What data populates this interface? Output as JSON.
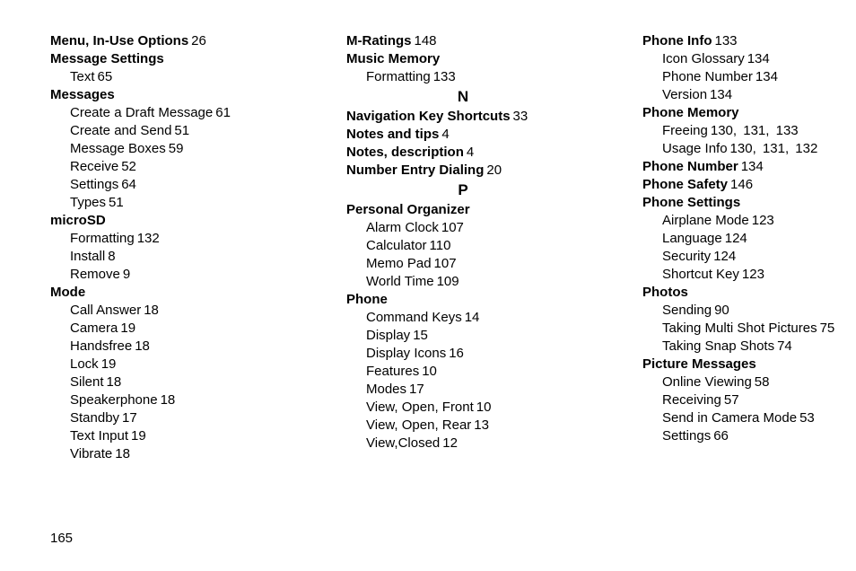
{
  "page_number": "165",
  "columns": [
    [
      {
        "type": "topic",
        "head": "Menu, In-Use Options",
        "page": "26"
      },
      {
        "type": "topic",
        "head": "Message Settings"
      },
      {
        "type": "sub",
        "text": "Text",
        "page": "65"
      },
      {
        "type": "topic",
        "head": "Messages"
      },
      {
        "type": "sub",
        "text": "Create a Draft Message",
        "page": "61"
      },
      {
        "type": "sub",
        "text": "Create and Send",
        "page": "51"
      },
      {
        "type": "sub",
        "text": "Message Boxes",
        "page": "59"
      },
      {
        "type": "sub",
        "text": "Receive",
        "page": "52"
      },
      {
        "type": "sub",
        "text": "Settings",
        "page": "64"
      },
      {
        "type": "sub",
        "text": "Types",
        "page": "51"
      },
      {
        "type": "topic",
        "head": "microSD"
      },
      {
        "type": "sub",
        "text": "Formatting",
        "page": "132"
      },
      {
        "type": "sub",
        "text": "Install",
        "page": "8"
      },
      {
        "type": "sub",
        "text": "Remove",
        "page": "9"
      },
      {
        "type": "topic",
        "head": "Mode"
      },
      {
        "type": "sub",
        "text": "Call Answer",
        "page": "18"
      },
      {
        "type": "sub",
        "text": "Camera",
        "page": "19"
      },
      {
        "type": "sub",
        "text": "Handsfree",
        "page": "18"
      },
      {
        "type": "sub",
        "text": "Lock",
        "page": "19"
      },
      {
        "type": "sub",
        "text": "Silent",
        "page": "18"
      },
      {
        "type": "sub",
        "text": "Speakerphone",
        "page": "18"
      },
      {
        "type": "sub",
        "text": "Standby",
        "page": "17"
      },
      {
        "type": "sub",
        "text": "Text Input",
        "page": "19"
      },
      {
        "type": "sub",
        "text": "Vibrate",
        "page": "18"
      }
    ],
    [
      {
        "type": "topic",
        "head": "M-Ratings",
        "page": "148"
      },
      {
        "type": "topic",
        "head": "Music Memory"
      },
      {
        "type": "sub",
        "text": "Formatting",
        "page": "133"
      },
      {
        "type": "letter",
        "letter": "N"
      },
      {
        "type": "topic",
        "head": "Navigation Key Shortcuts",
        "page": "33"
      },
      {
        "type": "topic",
        "head": "Notes and tips",
        "page": "4"
      },
      {
        "type": "topic",
        "head": "Notes, description",
        "page": "4"
      },
      {
        "type": "topic",
        "head": "Number Entry Dialing",
        "page": "20"
      },
      {
        "type": "letter",
        "letter": "P"
      },
      {
        "type": "topic",
        "head": "Personal Organizer"
      },
      {
        "type": "sub",
        "text": "Alarm Clock",
        "page": "107"
      },
      {
        "type": "sub",
        "text": "Calculator",
        "page": "110"
      },
      {
        "type": "sub",
        "text": "Memo Pad",
        "page": "107"
      },
      {
        "type": "sub",
        "text": "World Time",
        "page": "109"
      },
      {
        "type": "topic",
        "head": "Phone"
      },
      {
        "type": "sub",
        "text": "Command Keys",
        "page": "14"
      },
      {
        "type": "sub",
        "text": "Display",
        "page": "15"
      },
      {
        "type": "sub",
        "text": "Display Icons",
        "page": "16"
      },
      {
        "type": "sub",
        "text": "Features",
        "page": "10"
      },
      {
        "type": "sub",
        "text": "Modes",
        "page": "17"
      },
      {
        "type": "sub",
        "text": "View, Open, Front",
        "page": "10"
      },
      {
        "type": "sub",
        "text": "View, Open, Rear",
        "page": "13"
      },
      {
        "type": "sub",
        "text": "View,Closed",
        "page": "12"
      }
    ],
    [
      {
        "type": "topic",
        "head": "Phone Info",
        "page": "133"
      },
      {
        "type": "sub",
        "text": "Icon Glossary",
        "page": "134"
      },
      {
        "type": "sub",
        "text": "Phone Number",
        "page": "134"
      },
      {
        "type": "sub",
        "text": "Version",
        "page": "134"
      },
      {
        "type": "topic",
        "head": "Phone Memory"
      },
      {
        "type": "sub",
        "text": "Freeing",
        "pages": [
          "130",
          "131",
          "133"
        ]
      },
      {
        "type": "sub",
        "text": "Usage Info",
        "pages": [
          "130",
          "131",
          "132"
        ]
      },
      {
        "type": "topic",
        "head": "Phone Number",
        "page": "134"
      },
      {
        "type": "topic",
        "head": "Phone Safety",
        "page": "146"
      },
      {
        "type": "topic",
        "head": "Phone Settings"
      },
      {
        "type": "sub",
        "text": "Airplane Mode",
        "page": "123"
      },
      {
        "type": "sub",
        "text": "Language",
        "page": "124"
      },
      {
        "type": "sub",
        "text": "Security",
        "page": "124"
      },
      {
        "type": "sub",
        "text": "Shortcut Key",
        "page": "123"
      },
      {
        "type": "topic",
        "head": "Photos"
      },
      {
        "type": "sub",
        "text": "Sending",
        "page": "90"
      },
      {
        "type": "sub",
        "text": "Taking Multi Shot Pictures",
        "page": "75"
      },
      {
        "type": "sub",
        "text": "Taking Snap Shots",
        "page": "74"
      },
      {
        "type": "topic",
        "head": "Picture Messages"
      },
      {
        "type": "sub",
        "text": "Online Viewing",
        "page": "58"
      },
      {
        "type": "sub",
        "text": "Receiving",
        "page": "57"
      },
      {
        "type": "sub",
        "text": "Send in Camera Mode",
        "page": "53"
      },
      {
        "type": "sub",
        "text": "Settings",
        "page": "66"
      }
    ]
  ]
}
